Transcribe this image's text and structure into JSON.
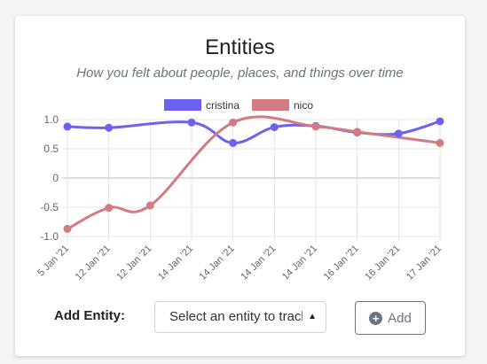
{
  "card": {
    "title": "Entities",
    "subtitle": "How you felt about people, places, and things over time"
  },
  "controls": {
    "label": "Add Entity:",
    "select_value": "Select an entity to track",
    "add_label": "Add"
  },
  "chart_data": {
    "type": "line",
    "categories": [
      "5 Jan '21",
      "12 Jan '21",
      "12 Jan '21",
      "14 Jan '21",
      "14 Jan '21",
      "14 Jan '21",
      "14 Jan '21",
      "16 Jan '21",
      "16 Jan '21",
      "17 Jan '21"
    ],
    "yticks": [
      "1.0",
      "0.5",
      "0",
      "-0.5",
      "-1.0"
    ],
    "ylim": [
      -1.0,
      1.0
    ],
    "legend_position": "top",
    "series": [
      {
        "name": "cristina",
        "color": "#6b63ee",
        "values": [
          0.88,
          0.86,
          null,
          0.95,
          0.6,
          0.87,
          0.89,
          0.78,
          0.76,
          0.97
        ]
      },
      {
        "name": "nico",
        "color": "#d27b80",
        "values": [
          -0.87,
          -0.51,
          -0.47,
          null,
          0.95,
          null,
          0.88,
          0.79,
          null,
          0.6
        ]
      }
    ]
  }
}
